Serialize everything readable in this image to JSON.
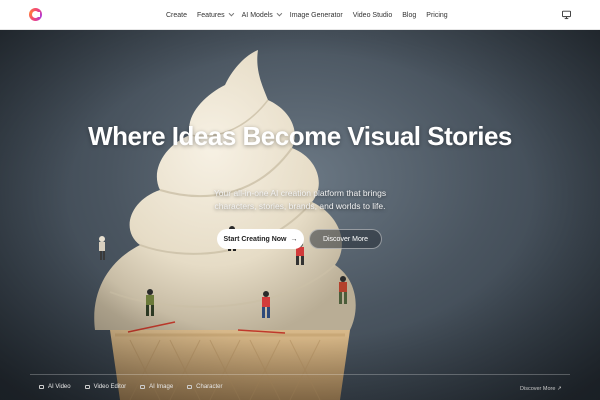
{
  "nav": {
    "menu": [
      {
        "label": "Create",
        "dropdown": false
      },
      {
        "label": "Features",
        "dropdown": true
      },
      {
        "label": "AI Models",
        "dropdown": true
      },
      {
        "label": "Image Generator",
        "dropdown": false
      },
      {
        "label": "Video Studio",
        "dropdown": false
      },
      {
        "label": "Blog",
        "dropdown": false
      },
      {
        "label": "Pricing",
        "dropdown": false
      }
    ],
    "logo_icon": "brand-logo-icon",
    "right_icon": "monitor-icon"
  },
  "hero": {
    "headline": "Where Ideas Become Visual Stories",
    "subtitle": "Your all-in-one AI creation platform that brings characters, stories, brands, and worlds to life.",
    "primary_button": "Start Creating Now",
    "primary_arrow": "→",
    "secondary_button": "Discover More"
  },
  "bottom": {
    "items": [
      {
        "label": "AI Video",
        "icon": "video-icon"
      },
      {
        "label": "Video Editor",
        "icon": "editor-icon"
      },
      {
        "label": "AI Image",
        "icon": "image-icon"
      },
      {
        "label": "Character",
        "icon": "character-icon"
      }
    ],
    "discover_more": "Discover More",
    "discover_arrow": "↗"
  },
  "colors": {
    "nav_bg": "#ffffff",
    "hero_bg": "#4a5560",
    "primary_btn_bg": "#ffffff"
  }
}
